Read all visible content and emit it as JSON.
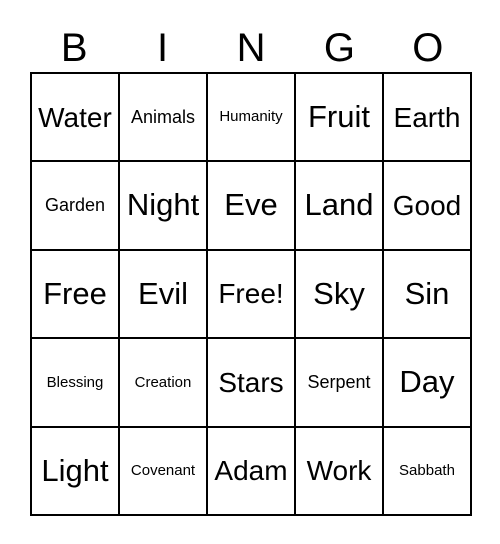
{
  "card": {
    "header_letters": [
      "B",
      "I",
      "N",
      "G",
      "O"
    ],
    "colors": {
      "background": "#ffffff",
      "text": "#000000",
      "border": "#000000"
    },
    "grid": {
      "rows": 5,
      "columns": 5,
      "free_space": "Free!",
      "cells": [
        [
          {
            "label": "Water",
            "size": "lg"
          },
          {
            "label": "Animals",
            "size": "sm"
          },
          {
            "label": "Humanity",
            "size": "xs"
          },
          {
            "label": "Fruit",
            "size": "xl"
          },
          {
            "label": "Earth",
            "size": "lg"
          }
        ],
        [
          {
            "label": "Garden",
            "size": "sm"
          },
          {
            "label": "Night",
            "size": "xl"
          },
          {
            "label": "Eve",
            "size": "xl"
          },
          {
            "label": "Land",
            "size": "xl"
          },
          {
            "label": "Good",
            "size": "lg"
          }
        ],
        [
          {
            "label": "Free",
            "size": "xl"
          },
          {
            "label": "Evil",
            "size": "xl"
          },
          {
            "label": "Free!",
            "size": "lg"
          },
          {
            "label": "Sky",
            "size": "xl"
          },
          {
            "label": "Sin",
            "size": "xl"
          }
        ],
        [
          {
            "label": "Blessing",
            "size": "xs"
          },
          {
            "label": "Creation",
            "size": "xs"
          },
          {
            "label": "Stars",
            "size": "lg"
          },
          {
            "label": "Serpent",
            "size": "sm"
          },
          {
            "label": "Day",
            "size": "xl"
          }
        ],
        [
          {
            "label": "Light",
            "size": "xl"
          },
          {
            "label": "Covenant",
            "size": "xs"
          },
          {
            "label": "Adam",
            "size": "lg"
          },
          {
            "label": "Work",
            "size": "lg"
          },
          {
            "label": "Sabbath",
            "size": "xs"
          }
        ]
      ]
    }
  }
}
